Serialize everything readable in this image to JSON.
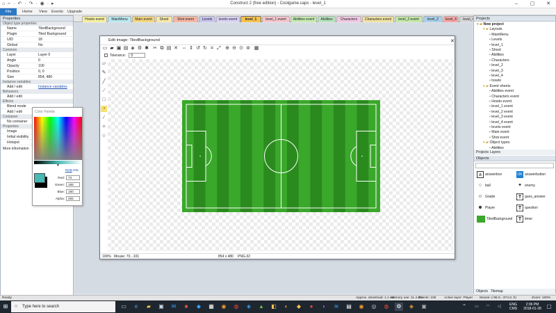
{
  "app": {
    "title": "Construct 2  (free edition) - Coolgame.capx - level_1",
    "quick_access": "⌂ ⌐ · ↶ · ↷ · ◉ · ▸"
  },
  "menu": [
    "File",
    "Home",
    "View",
    "Events",
    "Upgrade"
  ],
  "tabs": [
    {
      "label": "Howto event",
      "color": "#f7f0a0"
    },
    {
      "label": "MainMenu",
      "color": "#b9e7ef"
    },
    {
      "label": "Main event",
      "color": "#f5d57e"
    },
    {
      "label": "Shoot",
      "color": "#f7e8a8"
    },
    {
      "label": "Shot event",
      "color": "#f4b6a4"
    },
    {
      "label": "Levels",
      "color": "#c9c4ef"
    },
    {
      "label": "levels event",
      "color": "#d9d2f5"
    },
    {
      "label": "level_1",
      "color": "#f6c24f"
    },
    {
      "label": "level_1 event",
      "color": "#f5c6cc"
    },
    {
      "label": "Abilities event",
      "color": "#c6ebb0"
    },
    {
      "label": "Abilities",
      "color": "#b7e3bd"
    },
    {
      "label": "Characters",
      "color": "#f2c8e4"
    },
    {
      "label": "Characters event",
      "color": "#f0e3a2"
    },
    {
      "label": "level_2 event",
      "color": "#c4e8a8"
    },
    {
      "label": "level_2",
      "color": "#a9cfea"
    },
    {
      "label": "level_4",
      "color": "#f6a5a5"
    },
    {
      "label": "level_4 event",
      "color": "#d5d5d5"
    }
  ],
  "properties": {
    "header": "Properties",
    "sections": [
      {
        "title": "Object type properties",
        "rows": [
          {
            "k": "Name",
            "v": "TiledBackground"
          },
          {
            "k": "Plugin",
            "v": "Tiled Background"
          },
          {
            "k": "UID",
            "v": "18"
          },
          {
            "k": "Global",
            "v": "No"
          }
        ]
      },
      {
        "title": "Common",
        "rows": [
          {
            "k": "Layer",
            "v": "Layer 0"
          },
          {
            "k": "Angle",
            "v": "0"
          },
          {
            "k": "Opacity",
            "v": "100"
          },
          {
            "k": "Position",
            "v": "0, 0"
          },
          {
            "k": "Size",
            "v": "854, 480"
          }
        ]
      },
      {
        "title": "Instance variables",
        "rows": [
          {
            "k": "Add / edit",
            "v": "Instance variables",
            "link": true
          }
        ]
      },
      {
        "title": "Behaviors",
        "rows": [
          {
            "k": "Add / edit",
            "v": ""
          }
        ]
      },
      {
        "title": "Effects",
        "rows": [
          {
            "k": "Blend mode",
            "v": ""
          },
          {
            "k": "Add / edit",
            "v": ""
          }
        ]
      },
      {
        "title": "Container",
        "rows": [
          {
            "k": "No container",
            "v": ""
          }
        ]
      },
      {
        "title": "Properties",
        "rows": [
          {
            "k": "Image",
            "v": ""
          },
          {
            "k": "Initial visibility",
            "v": ""
          },
          {
            "k": "Hotspot",
            "v": ""
          }
        ]
      }
    ],
    "more_info": "More information"
  },
  "editor": {
    "title": "Edit image: TiledBackground",
    "tolerance_label": "Tolerance:",
    "tolerance_value": "0",
    "zoom": "100%",
    "mouse": "Mouse: 70, -101",
    "dims": "854 x 480",
    "format": "PNG-32"
  },
  "palette": {
    "title": "Color Palette",
    "mode_rgb": "RGB",
    "mode_hsl": "HSL",
    "fields": [
      {
        "label": "Red:",
        "value": "73"
      },
      {
        "label": "Green:",
        "value": "185"
      },
      {
        "label": "Blue:",
        "value": "180"
      },
      {
        "label": "Alpha:",
        "value": "255"
      }
    ],
    "color": "#49b9b4"
  },
  "projects": {
    "header": "Projects",
    "tree": [
      {
        "label": "New project",
        "depth": 0,
        "bold": true
      },
      {
        "label": "Layouts",
        "depth": 1
      },
      {
        "label": "MainMenu",
        "depth": 2
      },
      {
        "label": "Levels",
        "depth": 2
      },
      {
        "label": "level_1",
        "depth": 2
      },
      {
        "label": "Shoot",
        "depth": 2
      },
      {
        "label": "Abilities",
        "depth": 2
      },
      {
        "label": "Characters",
        "depth": 2
      },
      {
        "label": "level_2",
        "depth": 2
      },
      {
        "label": "level_3",
        "depth": 2
      },
      {
        "label": "level_4",
        "depth": 2
      },
      {
        "label": "howto",
        "depth": 2
      },
      {
        "label": "Event sheets",
        "depth": 1
      },
      {
        "label": "Abilities event",
        "depth": 2
      },
      {
        "label": "Characters event",
        "depth": 2
      },
      {
        "label": "Howto event",
        "depth": 2
      },
      {
        "label": "level_1 event",
        "depth": 2
      },
      {
        "label": "level_2 event",
        "depth": 2
      },
      {
        "label": "level_3 event",
        "depth": 2
      },
      {
        "label": "level_4 event",
        "depth": 2
      },
      {
        "label": "levels event",
        "depth": 2
      },
      {
        "label": "Main event",
        "depth": 2
      },
      {
        "label": "Shot event",
        "depth": 2
      },
      {
        "label": "Object types",
        "depth": 1
      },
      {
        "label": "Abilities",
        "depth": 2
      }
    ],
    "tab_projects": "Projects",
    "tab_layers": "Layers"
  },
  "objects": {
    "header": "Objects",
    "items": [
      {
        "label": "answerbox",
        "icon": "a-icon"
      },
      {
        "label": "answerbutton",
        "icon": "ok-icon"
      },
      {
        "label": "ball",
        "icon": "ball-icon"
      },
      {
        "label": "enemy",
        "icon": "enemy-icon"
      },
      {
        "label": "Goalie",
        "icon": "goalie-icon"
      },
      {
        "label": "gues_answer",
        "icon": "text-icon"
      },
      {
        "label": "Player",
        "icon": "player-icon"
      },
      {
        "label": "question",
        "icon": "text-icon"
      },
      {
        "label": "TiledBackground",
        "icon": "tiled-icon"
      },
      {
        "label": "timer",
        "icon": "text-icon"
      }
    ],
    "tab_objects": "Objects",
    "tab_tilemap": "Tilemap"
  },
  "status": {
    "left": "Ready",
    "download": "Approx. download: 1.1 mb",
    "memory": "memory use: 11.4 mb",
    "events": "Events: 106",
    "layer": "Active layer: Player",
    "mouse": "Mouse: (-96.0, -374.0, 0)",
    "zoom": "Zoom: 100%"
  },
  "taskbar": {
    "search": "Type here to search",
    "lang1": "ENG",
    "lang2": "CMS",
    "time": "2:06 PM",
    "date": "2018-01-28"
  },
  "colors": {
    "field_light": "#3aa82a",
    "field_dark": "#2a8a1e"
  }
}
